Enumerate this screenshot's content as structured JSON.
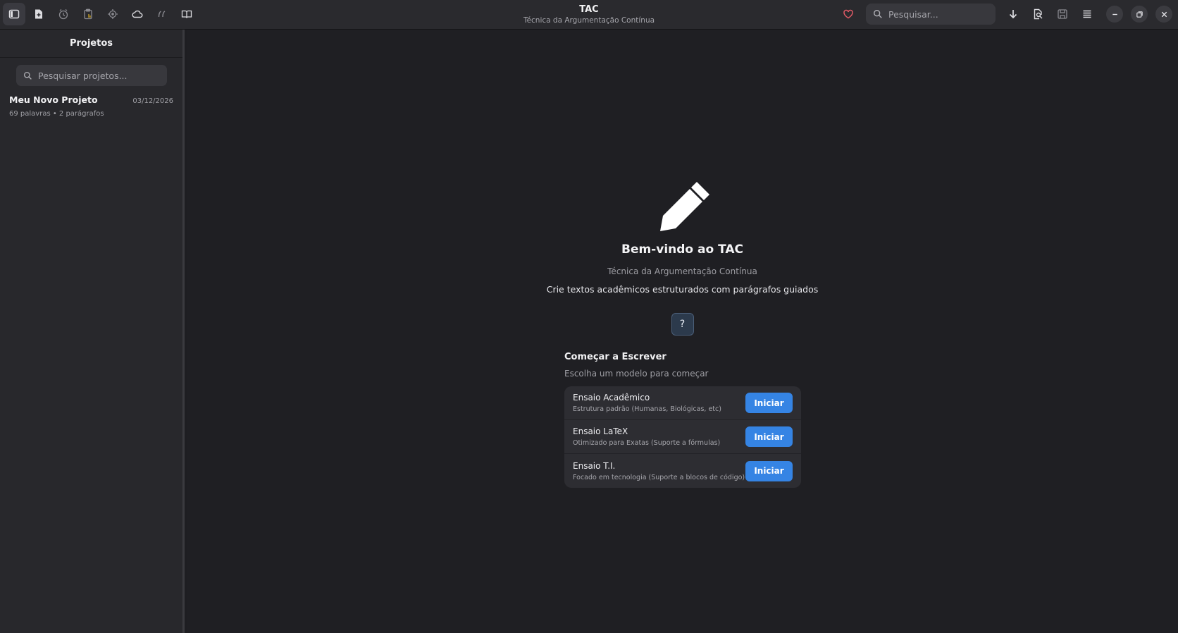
{
  "app": {
    "title": "TAC",
    "subtitle": "Técnica da Argumentação Contínua"
  },
  "toolbar": {
    "left_icons": [
      "sidebar-toggle-icon",
      "new-document-icon",
      "timer-icon",
      "clipboard-icon",
      "focus-target-icon",
      "cloud-icon",
      "quote-icon",
      "book-icon"
    ],
    "search_placeholder": "Pesquisar...",
    "right_icons": [
      "heart-icon",
      "download-icon",
      "document-search-icon",
      "save-icon",
      "menu-icon"
    ],
    "accent_heart": "#e05a66"
  },
  "sidebar": {
    "title": "Projetos",
    "search_placeholder": "Pesquisar projetos...",
    "projects": [
      {
        "name": "Meu Novo Projeto",
        "date": "03/12/2026",
        "meta": "69 palavras • 2 parágrafos"
      }
    ]
  },
  "welcome": {
    "icon": "pencil-icon",
    "title": "Bem-vindo ao TAC",
    "subtitle": "Técnica da Argumentação Contínua",
    "description": "Crie textos acadêmicos estruturados com parágrafos guiados",
    "help_label": "?"
  },
  "start": {
    "title": "Começar a Escrever",
    "subtitle": "Escolha um modelo para começar",
    "templates": [
      {
        "name": "Ensaio Acadêmico",
        "description": "Estrutura padrão (Humanas, Biológicas, etc)",
        "button": "Iniciar"
      },
      {
        "name": "Ensaio LaTeX",
        "description": "Otimizado para Exatas (Suporte a fórmulas)",
        "button": "Iniciar"
      },
      {
        "name": "Ensaio T.I.",
        "description": "Focado em tecnologia (Suporte a blocos de código)",
        "button": "Iniciar"
      }
    ]
  },
  "colors": {
    "accent_blue": "#3584e4",
    "background": "#1e1e22",
    "sidebar": "#28282c"
  }
}
